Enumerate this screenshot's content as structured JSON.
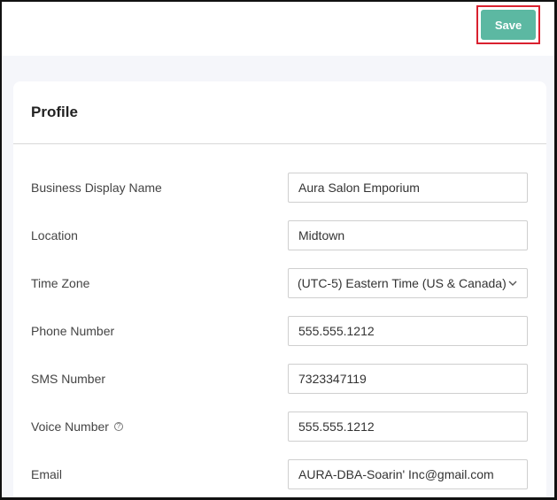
{
  "toolbar": {
    "save_label": "Save"
  },
  "profile": {
    "title": "Profile",
    "fields": {
      "business_display_name": {
        "label": "Business Display Name",
        "value": "Aura Salon Emporium"
      },
      "location": {
        "label": "Location",
        "value": "Midtown"
      },
      "time_zone": {
        "label": "Time Zone",
        "value": "(UTC-5) Eastern Time (US & Canada)"
      },
      "phone_number": {
        "label": "Phone Number",
        "value": "555.555.1212"
      },
      "sms_number": {
        "label": "SMS Number",
        "value": "7323347119"
      },
      "voice_number": {
        "label": "Voice Number",
        "value": "555.555.1212"
      },
      "email": {
        "label": "Email",
        "value": "AURA-DBA-Soarin' Inc@gmail.com"
      }
    }
  },
  "icons": {
    "info": "info-icon",
    "dropdown": "chevron-down-icon"
  },
  "colors": {
    "accent": "#5cb8a2",
    "highlight": "#d9202f"
  }
}
